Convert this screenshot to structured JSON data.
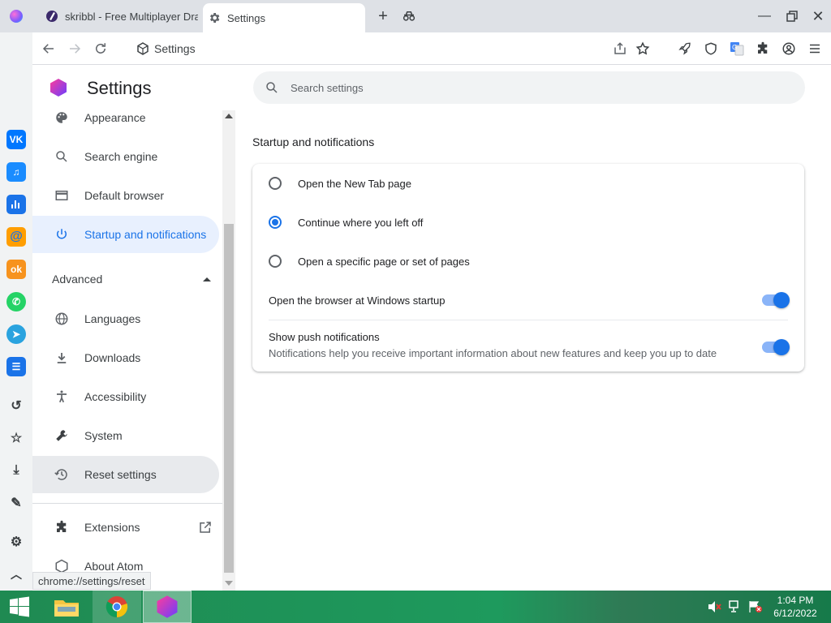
{
  "tabs": [
    {
      "label": "skribbl - Free Multiplayer Dra"
    },
    {
      "label": "Settings"
    }
  ],
  "toolbar": {
    "omnibox_text": "Settings"
  },
  "sidebar": {
    "title": "Settings",
    "items": [
      {
        "label": "Appearance"
      },
      {
        "label": "Search engine"
      },
      {
        "label": "Default browser"
      },
      {
        "label": "Startup and notifications"
      }
    ],
    "advanced_label": "Advanced",
    "advanced_items": [
      {
        "label": "Languages"
      },
      {
        "label": "Downloads"
      },
      {
        "label": "Accessibility"
      },
      {
        "label": "System"
      },
      {
        "label": "Reset settings"
      }
    ],
    "extensions_label": "Extensions",
    "about_label": "About Atom"
  },
  "search": {
    "placeholder": "Search settings"
  },
  "section": {
    "title": "Startup and notifications",
    "options": [
      {
        "label": "Open the New Tab page",
        "checked": false
      },
      {
        "label": "Continue where you left off",
        "checked": true
      },
      {
        "label": "Open a specific page or set of pages",
        "checked": false
      }
    ],
    "windows_startup_label": "Open the browser at Windows startup",
    "push_label": "Show push notifications",
    "push_desc": "Notifications help you receive important information about new features and keep you up to date"
  },
  "status_url": "chrome://settings/reset",
  "clock": {
    "time": "1:04 PM",
    "date": "6/12/2022"
  },
  "colors": {
    "accent": "#1a73e8",
    "active_bg": "#e8f0fe",
    "taskbar": "#1f8a52"
  }
}
